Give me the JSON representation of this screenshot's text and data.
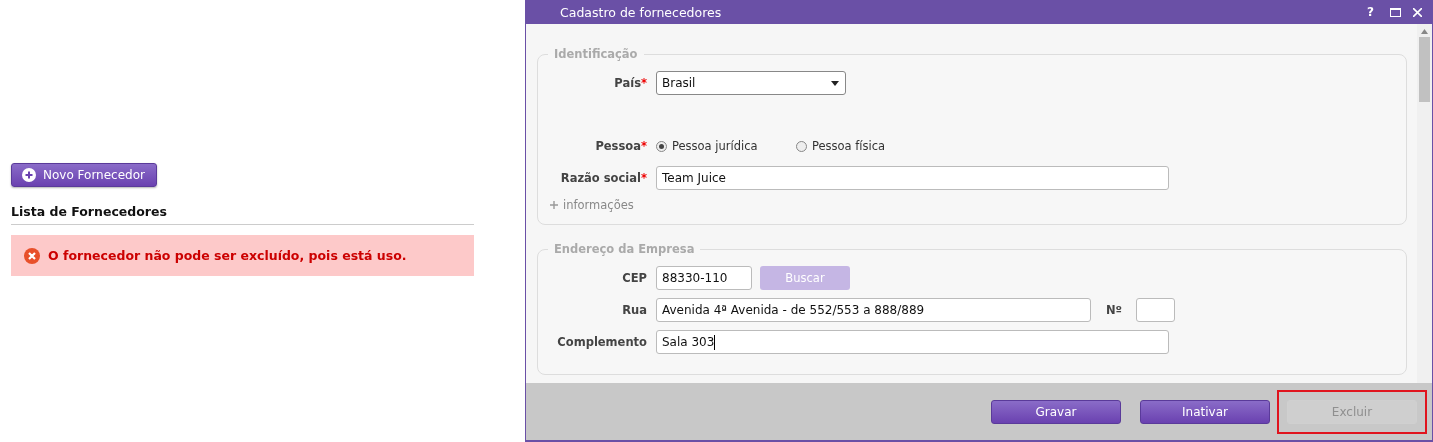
{
  "page": {
    "new_button": "Novo Fornecedor",
    "list_title": "Lista de Fornecedores",
    "error": "O fornecedor não pode ser excluído, pois está uso."
  },
  "dialog": {
    "title": "Cadastro de fornecedores",
    "help": "?",
    "sections": [
      {
        "legend": "Identificação",
        "more": "informações",
        "rows": [
          {
            "kind": "select",
            "label": "País",
            "required_mark": "*",
            "value": "Brasil"
          },
          {
            "kind": "radio",
            "label": "Pessoa",
            "required_mark": "*",
            "options": [
              {
                "label": "Pessoa jurídica",
                "selected": true
              },
              {
                "label": "Pessoa física",
                "selected": false
              }
            ]
          },
          {
            "kind": "text",
            "label": "Razão social",
            "required_mark": "*",
            "value": "Team Juice",
            "focused": false
          }
        ]
      },
      {
        "legend": "Endereço da Empresa",
        "rows": [
          {
            "kind": "cep",
            "label": "CEP",
            "value": "88330-110",
            "button": {
              "label": "Buscar",
              "disabled": true
            }
          },
          {
            "kind": "street",
            "label": "Rua",
            "value": "Avenida 4ª Avenida - de 552/553 a 888/889",
            "number_label": "Nº"
          },
          {
            "kind": "text",
            "label": "Complemento",
            "value": "Sala 303",
            "focused": true
          }
        ]
      }
    ],
    "buttons": [
      {
        "label": "Gravar",
        "disabled": false,
        "highlighted": false
      },
      {
        "label": "Inativar",
        "disabled": false,
        "highlighted": false
      },
      {
        "label": "Excluir",
        "disabled": true,
        "highlighted": true
      }
    ]
  }
}
